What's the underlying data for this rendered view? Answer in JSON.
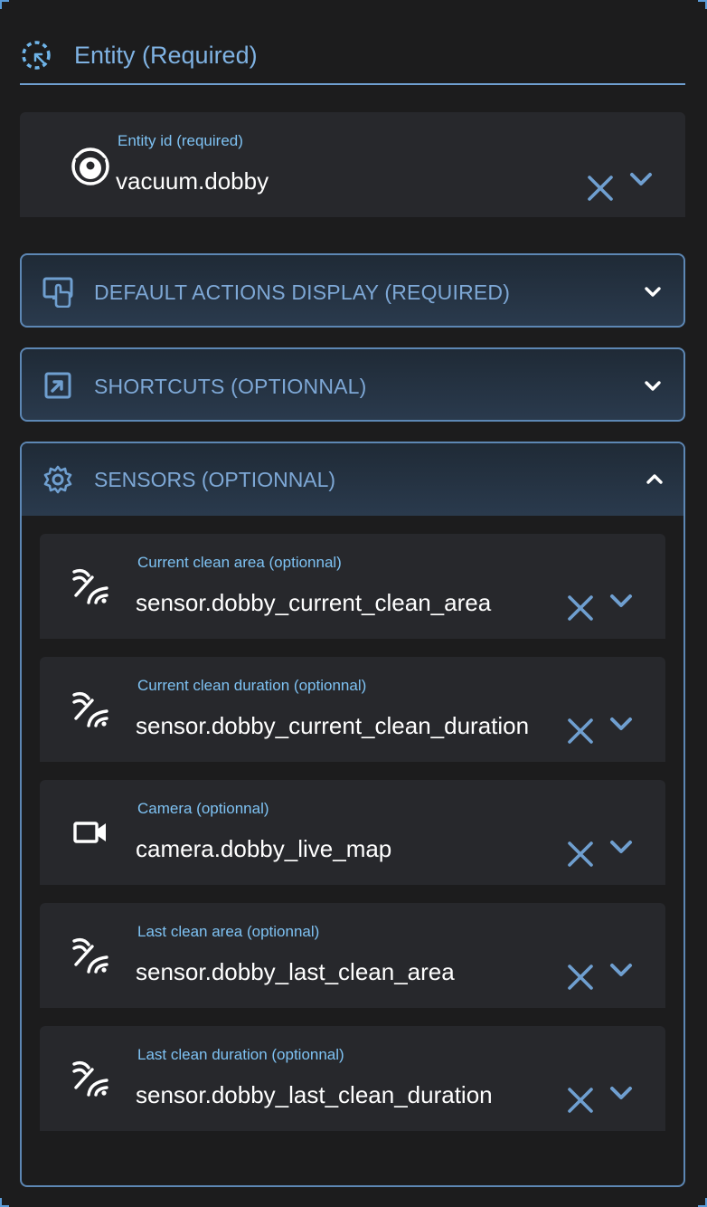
{
  "entity_section": {
    "title": "Entity (Required)",
    "icon": "dashed-circle-target-icon",
    "field": {
      "label": "Entity id (required)",
      "value": "vacuum.dobby",
      "icon": "robot-vacuum-icon"
    }
  },
  "panels": [
    {
      "title": "DEFAULT ACTIONS DISPLAY (REQUIRED)",
      "icon": "gesture-tap-icon",
      "expanded": false
    },
    {
      "title": "SHORTCUTS (OPTIONNAL)",
      "icon": "open-in-app-icon",
      "expanded": false
    },
    {
      "title": "SENSORS (OPTIONNAL)",
      "icon": "cog-sync-icon",
      "expanded": true
    }
  ],
  "sensors": [
    {
      "label": "Current clean area (optionnal)",
      "value": "sensor.dobby_current_clean_area",
      "icon": "signal-icon"
    },
    {
      "label": "Current clean duration (optionnal)",
      "value": "sensor.dobby_current_clean_duration",
      "icon": "signal-icon"
    },
    {
      "label": "Camera (optionnal)",
      "value": "camera.dobby_live_map",
      "icon": "video-camera-icon"
    },
    {
      "label": "Last clean area (optionnal)",
      "value": "sensor.dobby_last_clean_area",
      "icon": "signal-icon"
    },
    {
      "label": "Last clean duration (optionnal)",
      "value": "sensor.dobby_last_clean_duration",
      "icon": "signal-icon"
    }
  ],
  "colors": {
    "accent": "#6f9fd0",
    "label": "#7ec2f3",
    "field_bg": "#27282c",
    "page_bg": "#1c1c1d"
  }
}
